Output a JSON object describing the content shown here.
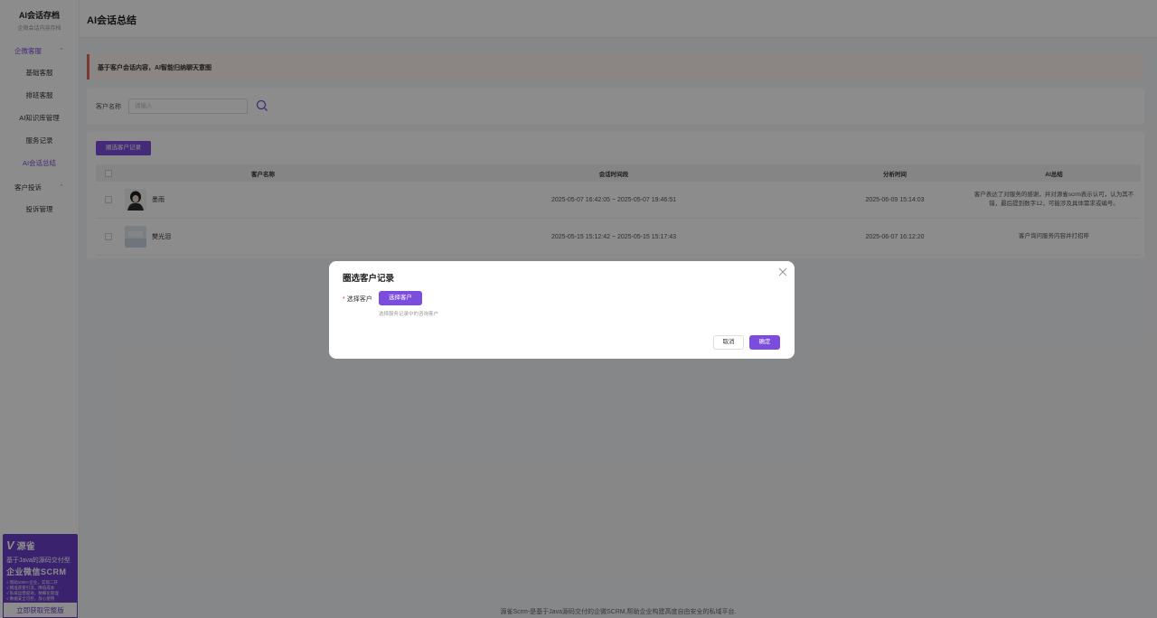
{
  "sidebar": {
    "brand_title": "AI会话存档",
    "brand_subtitle": "企微会话内容存档",
    "group1": "企微客服",
    "group1_items": [
      "基础客服",
      "排班客服",
      "AI知识库管理",
      "服务记录",
      "AI会话总结"
    ],
    "group2": "客户投诉",
    "group2_items": [
      "投诉管理"
    ]
  },
  "promo": {
    "logo": "源雀",
    "line1": "基于Java的源码交付型",
    "line2": "企业微信SCRM",
    "features": [
      "√ 帮助1000+企业，实现二开",
      "√ 精准获客引流，降低成本",
      "√ 私域运营提效，精细化管理",
      "√ 数据安全可控，放心使用"
    ],
    "button": "立即获取完整版"
  },
  "header": {
    "title": "AI会话总结"
  },
  "notice": "基于客户会话内容，AI智能归纳聊天意图",
  "search": {
    "label": "客户名称",
    "placeholder": "请输入"
  },
  "table": {
    "add_button": "圈选客户记录",
    "headers": [
      "客户名称",
      "会话时间段",
      "分析时间",
      "AI总结"
    ],
    "rows": [
      {
        "name": "墨雨",
        "period": "2025-05-07 16:42:05 ~ 2025-05-07 19:46:51",
        "analyzed": "2025-06-09 15:14:03",
        "summary": "客户表达了对服务的感谢，并对源雀scrm表示认可，认为其不错，最后提到数字12，可能涉及具体需求或编号。"
      },
      {
        "name": "樊光泪",
        "period": "2025-05-15 15:12:42 ~ 2025-05-15 15:17:43",
        "analyzed": "2025-06-07 16:12:20",
        "summary": "客户询问服务内容并打招呼"
      }
    ]
  },
  "footer": "源雀Scrm-是基于Java源码交付的企微SCRM,帮助企业构建高度自由安全的私域平台.",
  "modal": {
    "title": "圈选客户记录",
    "field_label": "选择客户",
    "required_mark": "*",
    "pick_button": "选择客户",
    "hint": "选择服务记录中的咨询客户",
    "cancel": "取消",
    "confirm": "确定"
  },
  "colors": {
    "accent": "#7c4ddc",
    "notice_border": "#e06a5a",
    "notice_bg": "#fdf3ef"
  }
}
